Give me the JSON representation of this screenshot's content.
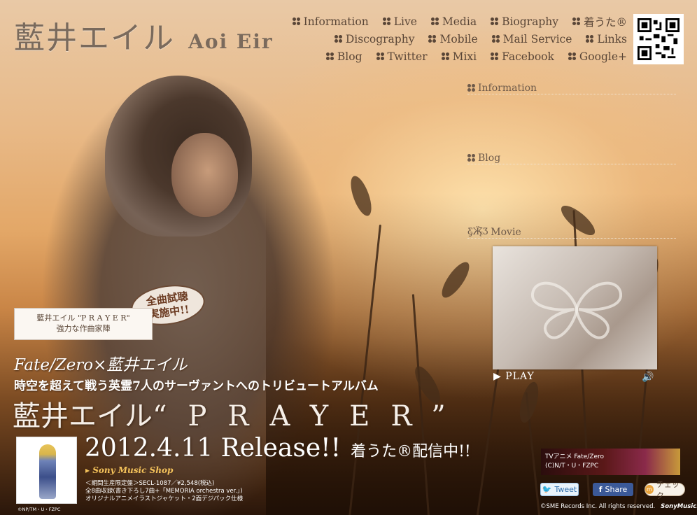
{
  "header": {
    "logo_jp": "藍井エイル",
    "logo_en": "Aoi Eir"
  },
  "nav": {
    "rows": [
      [
        "Information",
        "Live",
        "Media",
        "Biography",
        "着うた®"
      ],
      [
        "Discography",
        "Mobile",
        "Mail Service",
        "Links"
      ],
      [
        "Blog",
        "Twitter",
        "Mixi",
        "Facebook",
        "Google+"
      ]
    ]
  },
  "sidebar": {
    "information_title": "Information",
    "blog_title": "Blog",
    "movie_title": "Movie",
    "play_label": "▶ PLAY",
    "speaker_icon": "speaker-icon"
  },
  "promo": {
    "card_line1": "藍井エイル \"P R A Y E R\"",
    "card_line2": "強力な作曲家陣",
    "badge_line1": "全曲試聴",
    "badge_line2": "実施中!!",
    "tagline": "Fate/Zero×藍井エイル",
    "subline": "時空を超えて戦う英霊7人のサーヴァントへのトリビュートアルバム",
    "title_artist": "藍井エイル",
    "title_album": "“PRAYER”",
    "release": "2012.4.11 Release!!",
    "chakuuta": "着うた®配信中!!",
    "shop_link": "▸ Sony Music Shop",
    "detail_line1": "＜期間生産限定盤＞SECL-1087／¥2,548(税込)",
    "detail_line2": "全8曲収録(書き下ろし7曲+「MEMORIA orchestra ver.」)",
    "detail_line3": "オリジナルアニメイラストジャケット・2面デジパック仕様",
    "jacket_caption": "©NP/TM・U・FZPC"
  },
  "footer": {
    "banner_line1": "TVアニメ Fate/Zero",
    "banner_line2": "(C)N/T・U・FZPC",
    "tweet_label": "Tweet",
    "share_label": "Share",
    "check_label": "チェック",
    "copyright": "©SME Records Inc. All rights reserved.",
    "sony_logo": "SonyMusic."
  }
}
